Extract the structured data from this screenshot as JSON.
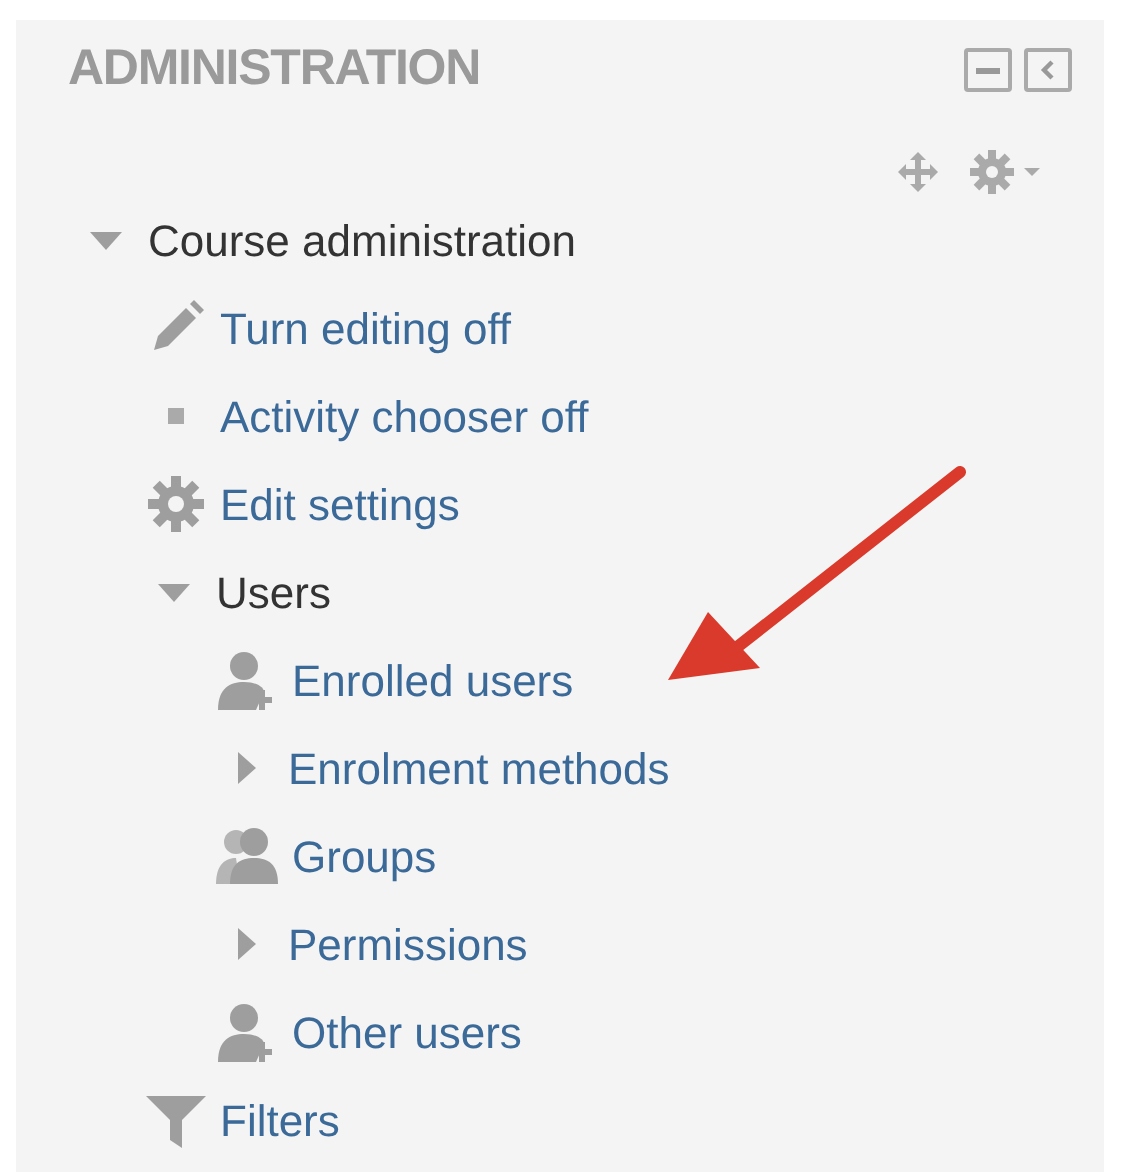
{
  "block": {
    "title": "ADMINISTRATION"
  },
  "tree": [
    {
      "label": "Course administration",
      "kind": "branch",
      "expanded": true,
      "children": [
        {
          "label": "Turn editing off",
          "kind": "edit"
        },
        {
          "label": "Activity chooser off",
          "kind": "option"
        },
        {
          "label": "Edit settings",
          "kind": "settings"
        },
        {
          "label": "Users",
          "kind": "branch",
          "expanded": true,
          "children": [
            {
              "label": "Enrolled users",
              "kind": "enrol"
            },
            {
              "label": "Enrolment methods",
              "kind": "branch-link",
              "expanded": false
            },
            {
              "label": "Groups",
              "kind": "groups"
            },
            {
              "label": "Permissions",
              "kind": "branch-link",
              "expanded": false
            },
            {
              "label": "Other users",
              "kind": "enrol"
            }
          ]
        },
        {
          "label": "Filters",
          "kind": "filter"
        }
      ]
    }
  ]
}
